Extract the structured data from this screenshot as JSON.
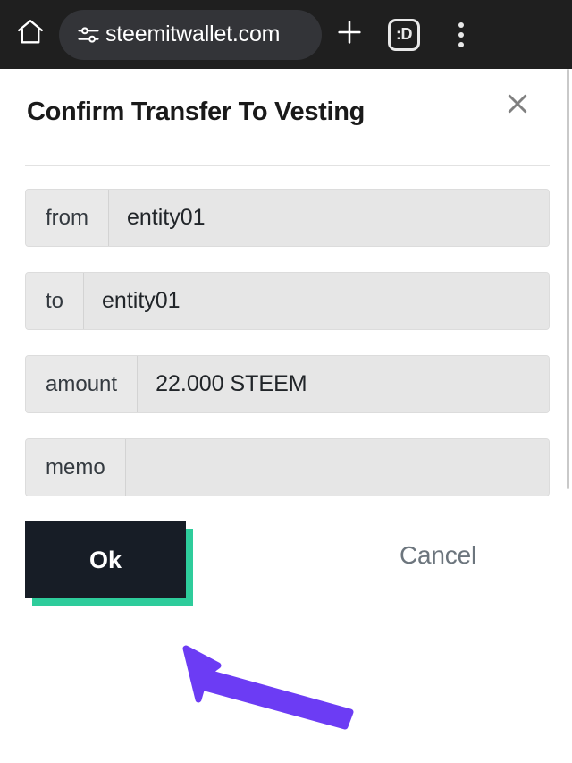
{
  "browser": {
    "home_icon": "home-icon",
    "url_tune_icon": "tune-icon",
    "url_text": "steemitwallet.com",
    "new_tab_icon": "plus-icon",
    "tab_count_label": ":D",
    "menu_icon": "three-dot-menu-icon"
  },
  "modal": {
    "title": "Confirm Transfer To Vesting",
    "close_icon": "close-icon",
    "fields": [
      {
        "label": "from",
        "value": "entity01"
      },
      {
        "label": "to",
        "value": "entity01"
      },
      {
        "label": "amount",
        "value": "22.000 STEEM"
      },
      {
        "label": "memo",
        "value": ""
      }
    ],
    "ok_label": "Ok",
    "cancel_label": "Cancel"
  },
  "annotation": {
    "arrow_icon": "arrow-pointer-icon",
    "arrow_color": "#6c3cf4",
    "arrow_target": "ok-button"
  },
  "colors": {
    "browser_bar": "#1f1f1f",
    "url_pill": "#333438",
    "ok_button": "#171d26",
    "ok_shadow_teal": "#2ecc9b",
    "cancel_text": "#6c757d",
    "field_bg": "#e9e9e9",
    "page_bg": "#ffffff"
  }
}
